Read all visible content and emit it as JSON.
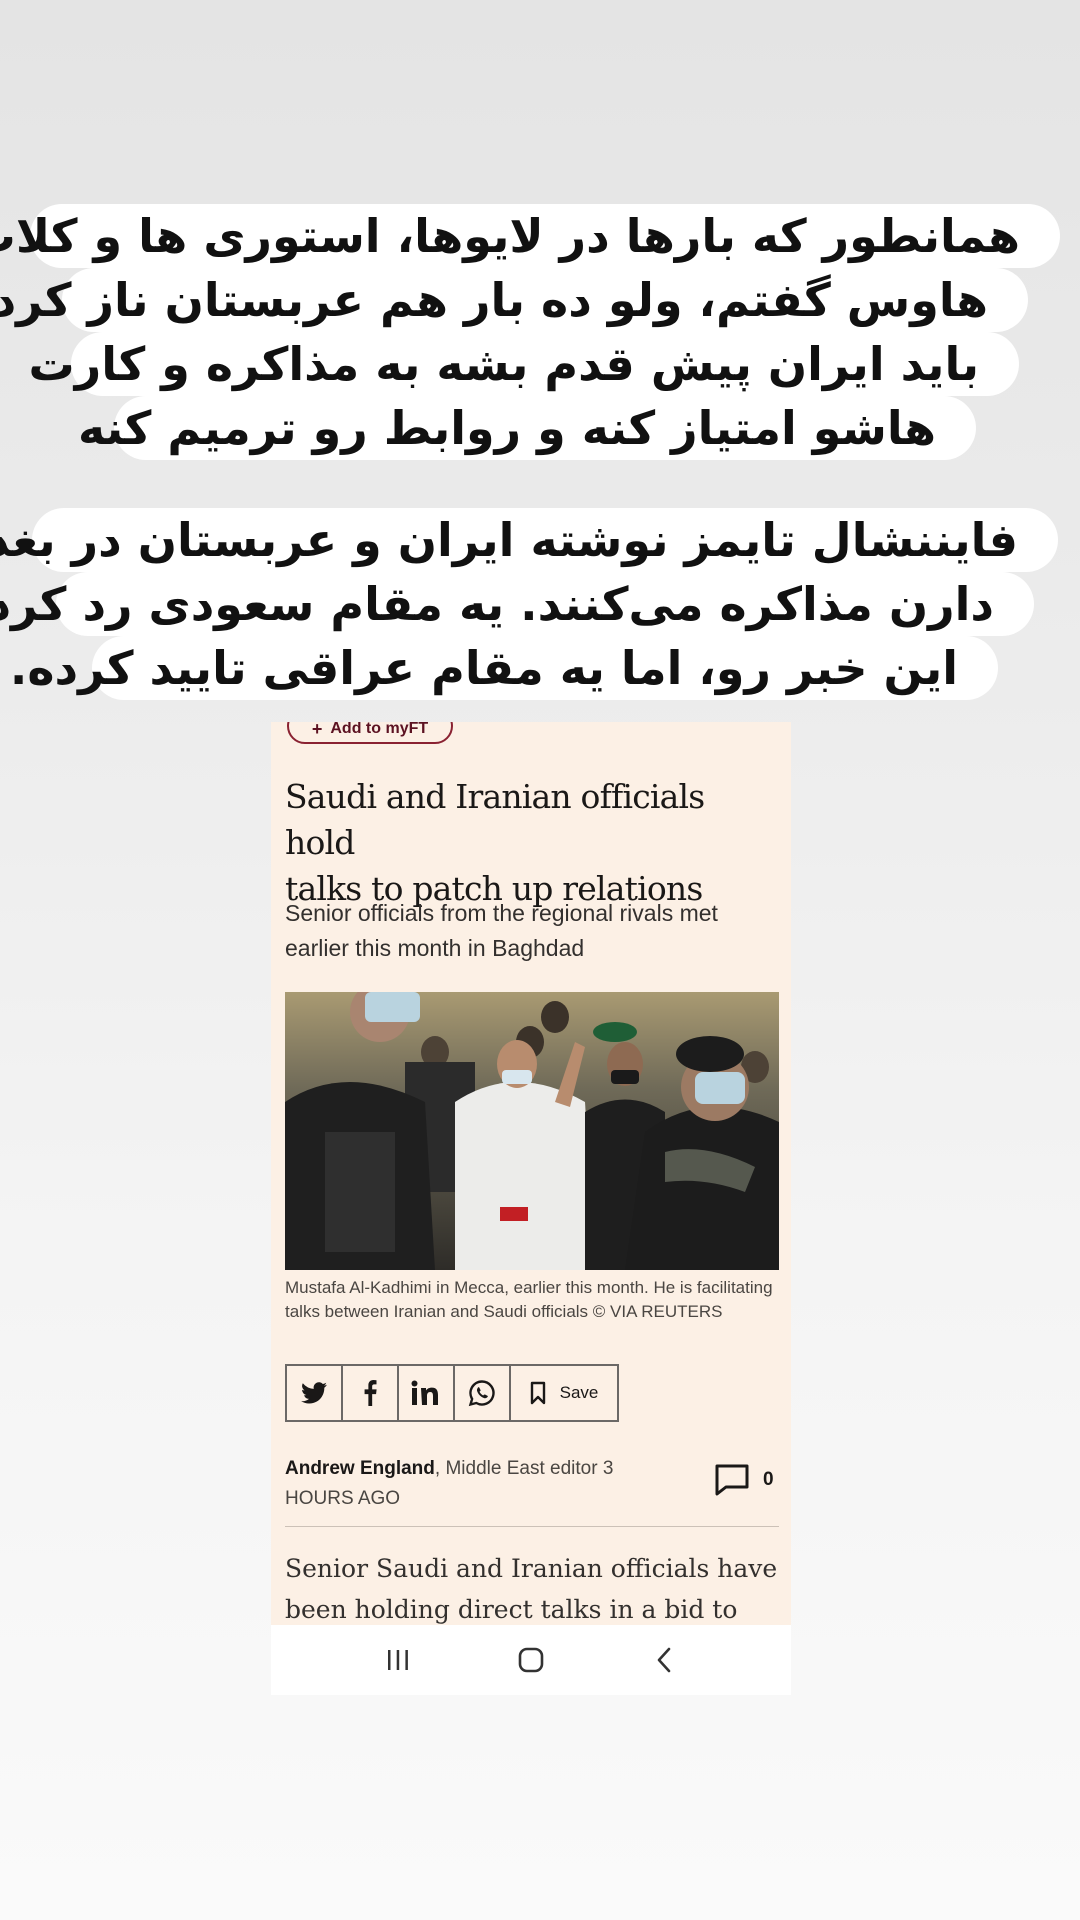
{
  "story_text": {
    "block1": [
      "همانطور که بارها در لایوها، استوری ها و کلاب",
      "هاوس گفتم، ولو ده بار هم عربستان ناز کرد",
      "باید ایران پیش قدم بشه به مذاکره و کارت",
      "هاشو امتیاز کنه و روابط رو ترمیم کنه"
    ],
    "block2": [
      "فایننشال تایمز نوشته ایران و عربستان در بغداد",
      "دارن مذاکره می‌کنند. یه مقام سعودی رد کرده",
      "این خبر رو، اما یه مقام عراقی تایید کرده."
    ]
  },
  "article": {
    "myft_label": "Add to myFT",
    "headline_line1": "Saudi and Iranian officials hold",
    "headline_line2": "talks to patch up relations",
    "standfirst_line1": "Senior officials from the regional rivals met",
    "standfirst_line2": "earlier this month in Baghdad",
    "photo_caption": "Mustafa Al-Kadhimi in Mecca, earlier this month. He is facilitating talks between Iranian and Saudi officials © VIA REUTERS",
    "share": {
      "icons": [
        "twitter-icon",
        "facebook-icon",
        "linkedin-icon",
        "whatsapp-icon",
        "bookmark-icon"
      ],
      "save_label": "Save"
    },
    "byline_author": "Andrew England",
    "byline_role": ", Middle East editor 3",
    "byline_time": "HOURS AGO",
    "comment_count": "0",
    "body_line1": "Senior Saudi and Iranian officials have",
    "body_line2": "been holding direct talks in a bid to"
  },
  "navbar": {
    "icons": [
      "recent-apps-icon",
      "home-icon",
      "back-icon"
    ]
  },
  "colors": {
    "article_bg": "#fcf0e5",
    "ft_claret": "#8a2232",
    "caption_bg": "#ffffff"
  }
}
